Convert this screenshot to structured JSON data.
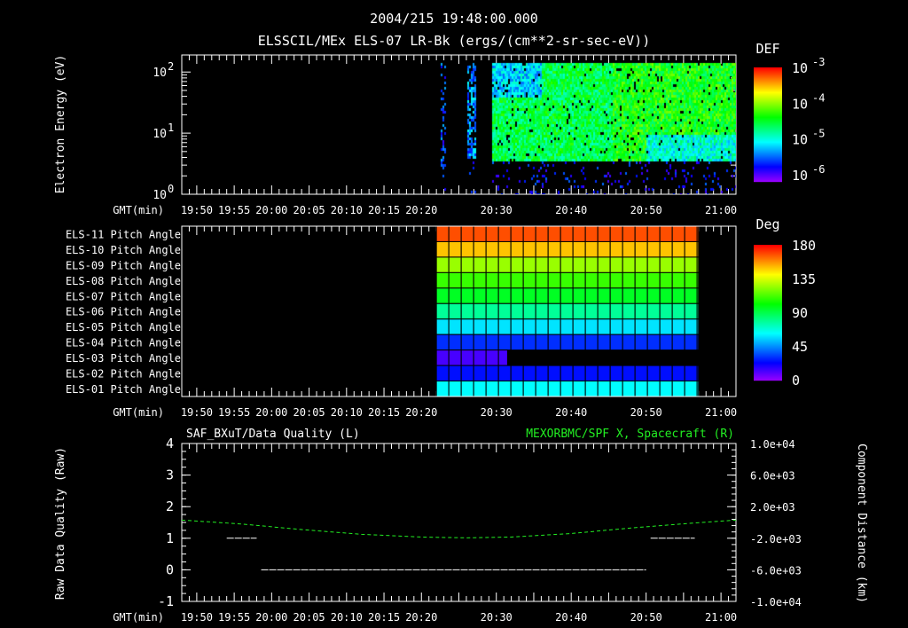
{
  "header": {
    "time": "2004/215 19:48:00.000",
    "subtitle": "ELSSCIL/MEx ELS-07 LR-Bk  (ergs/(cm**2-sr-sec-eV))"
  },
  "time_axis": {
    "label": "GMT(min)",
    "start_min": 1188,
    "end_min": 1262,
    "ticks": [
      {
        "label": "19:50",
        "t": 1190
      },
      {
        "label": "19:55",
        "t": 1195
      },
      {
        "label": "20:00",
        "t": 1200
      },
      {
        "label": "20:05",
        "t": 1205
      },
      {
        "label": "20:10",
        "t": 1210
      },
      {
        "label": "20:15",
        "t": 1215
      },
      {
        "label": "20:20",
        "t": 1220
      },
      {
        "label": "20:30",
        "t": 1230
      },
      {
        "label": "20:40",
        "t": 1240
      },
      {
        "label": "20:50",
        "t": 1250
      },
      {
        "label": "21:00",
        "t": 1260
      }
    ]
  },
  "chart_data": [
    {
      "type": "heatmap",
      "title": "ELSSCIL/MEx ELS-07 LR-Bk",
      "ylabel": "Electron Energy (eV)",
      "yscale": "log",
      "ylim": [
        1,
        190
      ],
      "ytick_labels": [
        {
          "label": "10",
          "exp": "0",
          "v": 1
        },
        {
          "label": "10",
          "exp": "1",
          "v": 10
        },
        {
          "label": "10",
          "exp": "2",
          "v": 100
        }
      ],
      "colorbar": {
        "title": "DEF",
        "scale": "log",
        "range_log10": [
          -6.2,
          -3
        ],
        "ticks": [
          {
            "label": "10",
            "exp": "-3",
            "v": -3
          },
          {
            "label": "10",
            "exp": "-4",
            "v": -4
          },
          {
            "label": "10",
            "exp": "-5",
            "v": -5
          },
          {
            "label": "10",
            "exp": "-6",
            "v": -6
          }
        ]
      },
      "regions": [
        {
          "start": 1222.5,
          "end": 1223.2,
          "emin": 3,
          "emax": 150,
          "log10_def": -5.6,
          "density": 0.35
        },
        {
          "start": 1226.0,
          "end": 1227.2,
          "emin": 3.5,
          "emax": 150,
          "log10_def": -5.4,
          "density": 0.7
        },
        {
          "start": 1229.3,
          "end": 1245.5,
          "emin": 3.6,
          "emax": 150,
          "log10_def": -4.6,
          "density": 0.95
        },
        {
          "start": 1245.5,
          "end": 1262,
          "emin": 3.6,
          "emax": 150,
          "log10_def": -4.4,
          "density": 0.95
        }
      ]
    },
    {
      "type": "heatmap",
      "title": "ELS Pitch Angle",
      "colorbar": {
        "title": "Deg",
        "range": [
          0,
          180
        ],
        "ticks": [
          "180",
          "135",
          "90",
          "45",
          "0"
        ]
      },
      "rows": [
        {
          "label": "ELS-11 Pitch Angle",
          "deg": 168,
          "start": 1222,
          "end": 1257
        },
        {
          "label": "ELS-10 Pitch Angle",
          "deg": 150,
          "start": 1222,
          "end": 1257
        },
        {
          "label": "ELS-09 Pitch Angle",
          "deg": 125,
          "start": 1222,
          "end": 1257
        },
        {
          "label": "ELS-08 Pitch Angle",
          "deg": 110,
          "start": 1222,
          "end": 1257
        },
        {
          "label": "ELS-07 Pitch Angle",
          "deg": 96,
          "start": 1222,
          "end": 1257
        },
        {
          "label": "ELS-06 Pitch Angle",
          "deg": 78,
          "start": 1222,
          "end": 1257
        },
        {
          "label": "ELS-05 Pitch Angle",
          "deg": 58,
          "start": 1222,
          "end": 1257
        },
        {
          "label": "ELS-04 Pitch Angle",
          "deg": 30,
          "start": 1222,
          "end": 1257
        },
        {
          "label": "ELS-03 Pitch Angle",
          "deg": 12,
          "start": 1222,
          "end": 1231.5
        },
        {
          "label": "ELS-02 Pitch Angle",
          "deg": 25,
          "start": 1222,
          "end": 1257
        },
        {
          "label": "ELS-01 Pitch Angle",
          "deg": 62,
          "start": 1222,
          "end": 1257
        }
      ]
    },
    {
      "type": "line",
      "title_left": "SAF_BXuT/Data Quality (L)",
      "title_right": "MEXORBMC/SPF X, Spacecraft (R)",
      "ylabel_left": "Raw Data Quality (Raw)",
      "ylabel_right": "Component Distance (km)",
      "ylim_left": [
        -1,
        4
      ],
      "yticks_left": [
        "4",
        "3",
        "2",
        "1",
        "0",
        "-1"
      ],
      "ylim_right": [
        -10000,
        10000
      ],
      "yticks_right": [
        "1.0e+04",
        "6.0e+03",
        "2.0e+03",
        "-2.0e+03",
        "-6.0e+03",
        "-1.0e+04"
      ],
      "quality_segments": [
        {
          "start": 1194,
          "end": 1198,
          "value": 1
        },
        {
          "start": 1198.6,
          "end": 1250,
          "value": 0
        },
        {
          "start": 1250.6,
          "end": 1256.5,
          "value": 1
        }
      ],
      "spacecraft_x": {
        "t": [
          1188,
          1196,
          1204,
          1212,
          1220,
          1226,
          1232,
          1240,
          1248,
          1256,
          1262
        ],
        "km": [
          300,
          -200,
          -900,
          -1500,
          -1850,
          -1950,
          -1850,
          -1400,
          -700,
          -100,
          300
        ]
      },
      "colors": {
        "quality": "#ffffff",
        "spacecraft": "#22ee22"
      }
    }
  ]
}
